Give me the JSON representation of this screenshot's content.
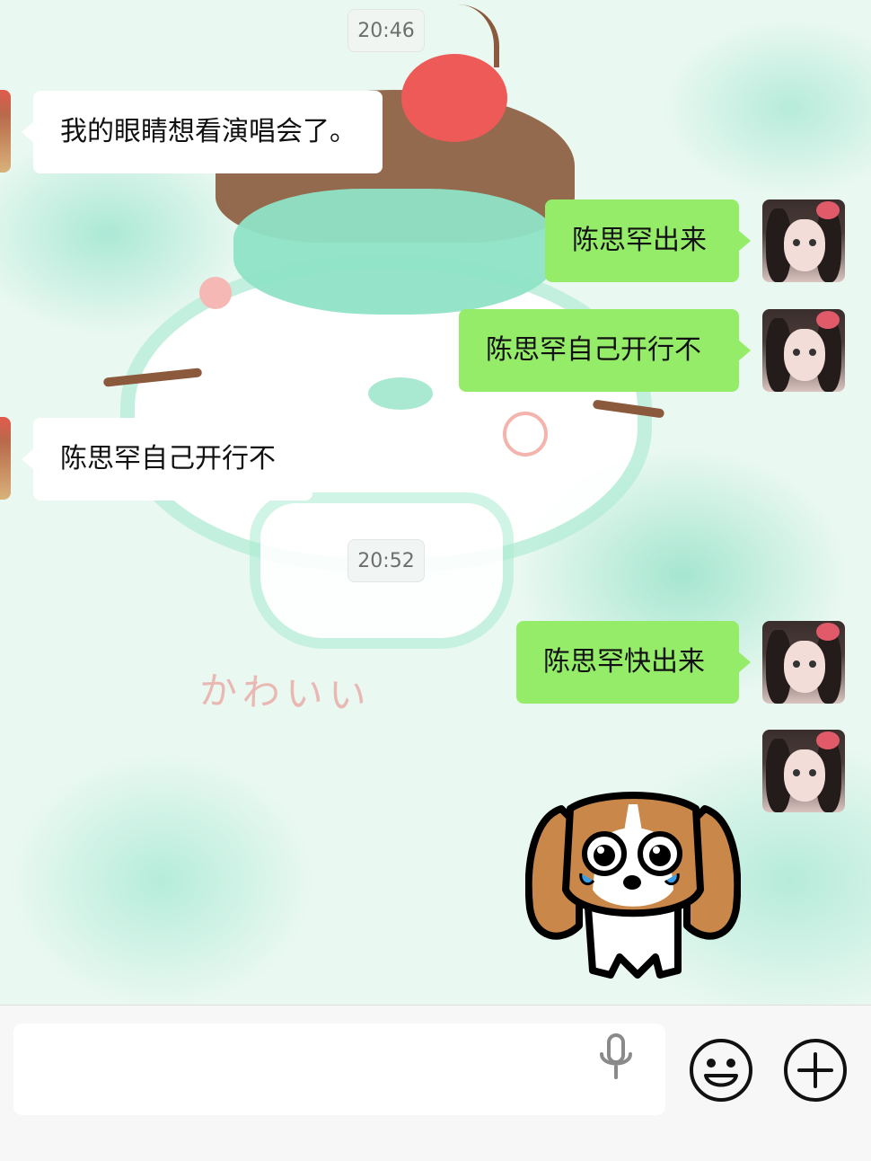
{
  "chat": {
    "timestamps": [
      "20:46",
      "20:52"
    ],
    "messages": [
      {
        "side": "in",
        "text": "我的眼睛想看演唱会了。"
      },
      {
        "side": "out",
        "text": "陈思罕出来"
      },
      {
        "side": "out",
        "text": "陈思罕自己开行不"
      },
      {
        "side": "in",
        "text": "陈思罕自己开行不"
      },
      {
        "side": "out",
        "text": "陈思罕快出来"
      },
      {
        "side": "out",
        "type": "sticker",
        "sticker": "crying-puppy-sticker"
      }
    ],
    "wallpaper_text": "かわいい"
  },
  "input_bar": {
    "text_value": "",
    "icons": [
      "microphone-icon",
      "emoji-icon",
      "plus-icon"
    ]
  },
  "colors": {
    "outgoing_bubble": "#95ec69",
    "incoming_bubble": "#ffffff",
    "wallpaper_mint": "#e9f8f1"
  }
}
